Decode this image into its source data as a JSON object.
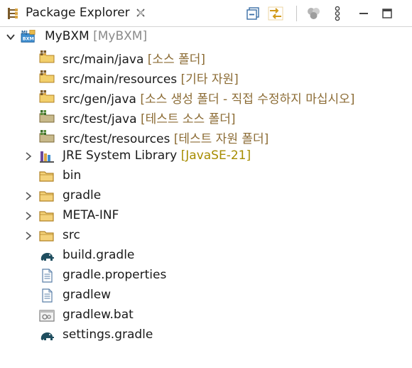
{
  "view": {
    "title": "Package Explorer"
  },
  "tree": {
    "project": {
      "label": "MyBXM",
      "decoration": "[MyBXM]"
    },
    "source_folders": [
      {
        "label": "src/main/java",
        "decoration": "[소스 폴더]"
      },
      {
        "label": "src/main/resources",
        "decoration": "[기타 자원]"
      },
      {
        "label": "src/gen/java",
        "decoration": "[소스 생성 폴더 - 직접 수정하지 마십시오]"
      },
      {
        "label": "src/test/java",
        "decoration": "[테스트 소스 폴더]"
      },
      {
        "label": "src/test/resources",
        "decoration": "[테스트 자원 폴더]"
      }
    ],
    "library": {
      "label": "JRE System Library",
      "decoration": "[JavaSE-21]"
    },
    "folders": [
      {
        "label": "bin"
      },
      {
        "label": "gradle"
      },
      {
        "label": "META-INF"
      },
      {
        "label": "src"
      }
    ],
    "files": [
      {
        "label": "build.gradle"
      },
      {
        "label": "gradle.properties"
      },
      {
        "label": "gradlew"
      },
      {
        "label": "gradlew.bat"
      },
      {
        "label": "settings.gradle"
      }
    ]
  },
  "icons": {
    "view": "package-explorer-icon",
    "close": "close-icon",
    "collapse_all": "collapse-all-icon",
    "link_with_editor": "link-with-editor-icon",
    "filters": "filters-icon",
    "view_menu": "view-menu-icon",
    "minimize": "minimize-icon",
    "maximize": "maximize-icon",
    "project": "bxm-project-icon",
    "source_folder": "package-folder-icon",
    "test_folder": "test-package-folder-icon",
    "library": "library-icon",
    "folder": "folder-icon",
    "gradle_file": "gradle-elephant-icon",
    "text_file": "text-file-icon",
    "bat_file": "batch-file-icon",
    "expand": "chevron-right-icon",
    "collapse": "chevron-down-icon"
  },
  "colors": {
    "decoration": "#8b6b34",
    "library_decoration": "#a68c00",
    "folder_yellow": "#e8b94a",
    "folder_outline": "#b08226",
    "gradle_elephant": "#1f4e5f"
  }
}
